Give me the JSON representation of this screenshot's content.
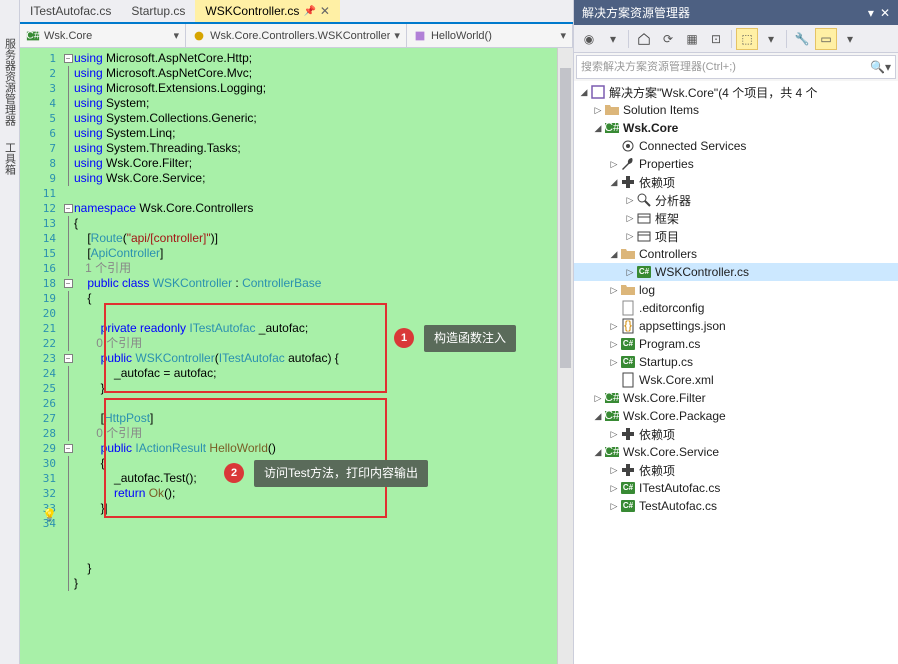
{
  "leftSidebar": {
    "t1": "服务器资源管理器",
    "t2": "工具箱"
  },
  "tabs": [
    {
      "label": "ITestAutofac.cs",
      "active": false
    },
    {
      "label": "Startup.cs",
      "active": false
    },
    {
      "label": "WSKController.cs",
      "active": true
    }
  ],
  "navBar": {
    "project": "Wsk.Core",
    "class": "Wsk.Core.Controllers.WSKController",
    "method": "HelloWorld()"
  },
  "annotations": {
    "a1": "构造函数注入",
    "a2": "访问Test方法，打印内容输出"
  },
  "code": {
    "usings": [
      "Microsoft.AspNetCore.Http",
      "Microsoft.AspNetCore.Mvc",
      "Microsoft.Extensions.Logging",
      "System",
      "System.Collections.Generic",
      "System.Linq",
      "System.Threading.Tasks",
      "Wsk.Core.Filter",
      "Wsk.Core.Service"
    ],
    "namespace": "Wsk.Core.Controllers",
    "route": "\"api/[controller]\"",
    "apiCtrl": "ApiController",
    "refLens1": "1 个引用",
    "refLens0": "0 个引用",
    "className": "WSKController",
    "baseClass": "ControllerBase",
    "fieldType": "ITestAutofac",
    "fieldName": "_autofac",
    "ctorParam": "ITestAutofac autofac",
    "assign": "_autofac = autofac;",
    "httpPost": "HttpPost",
    "retType": "IActionResult",
    "method": "HelloWorld",
    "body1": "_autofac.Test();",
    "body2_kw": "return",
    "body2_m": "Ok"
  },
  "rightPanel": {
    "title": "解决方案资源管理器",
    "searchPlaceholder": "搜索解决方案资源管理器(Ctrl+;)",
    "solution": "解决方案\"Wsk.Core\"(4 个项目，共 4 个"
  },
  "tree": [
    {
      "d": 0,
      "exp": "▷",
      "icon": "folder",
      "label": "Solution Items"
    },
    {
      "d": 0,
      "exp": "◢",
      "icon": "csproj",
      "label": "Wsk.Core",
      "bold": true
    },
    {
      "d": 1,
      "exp": "",
      "icon": "conn",
      "label": "Connected Services"
    },
    {
      "d": 1,
      "exp": "▷",
      "icon": "wrench",
      "label": "Properties"
    },
    {
      "d": 1,
      "exp": "◢",
      "icon": "ref",
      "label": "依赖项"
    },
    {
      "d": 2,
      "exp": "▷",
      "icon": "analyzer",
      "label": "分析器"
    },
    {
      "d": 2,
      "exp": "▷",
      "icon": "pkg",
      "label": "框架"
    },
    {
      "d": 2,
      "exp": "▷",
      "icon": "pkg",
      "label": "项目"
    },
    {
      "d": 1,
      "exp": "◢",
      "icon": "folder",
      "label": "Controllers"
    },
    {
      "d": 2,
      "exp": "▷",
      "icon": "cs",
      "label": "WSKController.cs",
      "selected": true
    },
    {
      "d": 1,
      "exp": "▷",
      "icon": "folder",
      "label": "log"
    },
    {
      "d": 1,
      "exp": "",
      "icon": "file",
      "label": ".editorconfig"
    },
    {
      "d": 1,
      "exp": "▷",
      "icon": "json",
      "label": "appsettings.json"
    },
    {
      "d": 1,
      "exp": "▷",
      "icon": "cs",
      "label": "Program.cs"
    },
    {
      "d": 1,
      "exp": "▷",
      "icon": "cs",
      "label": "Startup.cs"
    },
    {
      "d": 1,
      "exp": "",
      "icon": "xml",
      "label": "Wsk.Core.xml"
    },
    {
      "d": 0,
      "exp": "▷",
      "icon": "csproj",
      "label": "Wsk.Core.Filter"
    },
    {
      "d": 0,
      "exp": "◢",
      "icon": "csproj",
      "label": "Wsk.Core.Package"
    },
    {
      "d": 1,
      "exp": "▷",
      "icon": "ref",
      "label": "依赖项"
    },
    {
      "d": 0,
      "exp": "◢",
      "icon": "csproj",
      "label": "Wsk.Core.Service"
    },
    {
      "d": 1,
      "exp": "▷",
      "icon": "ref",
      "label": "依赖项"
    },
    {
      "d": 1,
      "exp": "▷",
      "icon": "cs",
      "label": "ITestAutofac.cs"
    },
    {
      "d": 1,
      "exp": "▷",
      "icon": "cs",
      "label": "TestAutofac.cs"
    }
  ]
}
